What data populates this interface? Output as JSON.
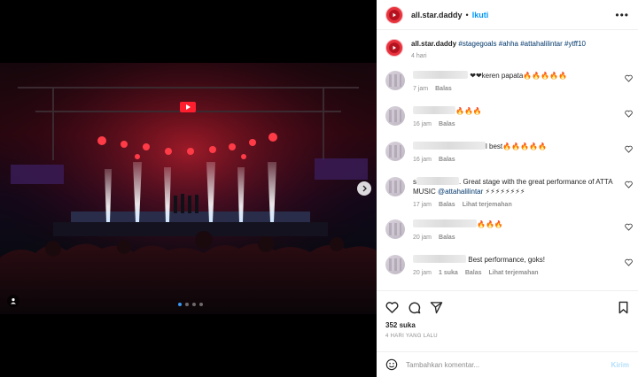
{
  "header": {
    "username": "all.star.daddy",
    "separator": "•",
    "follow_label": "Ikuti",
    "more_label": "•••"
  },
  "caption": {
    "username": "all.star.daddy",
    "hashtags": "#stagegoals #ahha #attahalilintar #ytff10",
    "time": "4 hari"
  },
  "comments": [
    {
      "text": "❤❤keren papata🔥🔥🔥🔥🔥",
      "time": "7 jam",
      "reply": "Balas"
    },
    {
      "text": "🔥🔥🔥",
      "time": "16 jam",
      "reply": "Balas"
    },
    {
      "text": "l best🔥🔥🔥🔥🔥",
      "time": "16 jam",
      "reply": "Balas"
    },
    {
      "text_prefix": "s",
      "text": ". Great stage with the great performance of ATTA MUSIC",
      "mention": "@attahalilintar",
      "suffix": "⚡⚡⚡⚡⚡⚡⚡⚡",
      "time": "17 jam",
      "reply": "Balas",
      "translate": "Lihat terjemahan"
    },
    {
      "text": "🔥🔥🔥",
      "time": "20 jam",
      "reply": "Balas"
    },
    {
      "text": "Best performance, goks!",
      "time": "20 jam",
      "likes": "1 suka",
      "reply": "Balas",
      "translate": "Lihat terjemahan"
    }
  ],
  "actions": {
    "likes": "352 suka",
    "date": "4 HARI YANG LALU"
  },
  "add_comment": {
    "placeholder": "Tambahkan komentar...",
    "post_label": "Kirim"
  },
  "carousel": {
    "slides": 4,
    "active_index": 0
  },
  "colors": {
    "accent": "#0095f6",
    "brand_avatar": "#e8333f"
  }
}
